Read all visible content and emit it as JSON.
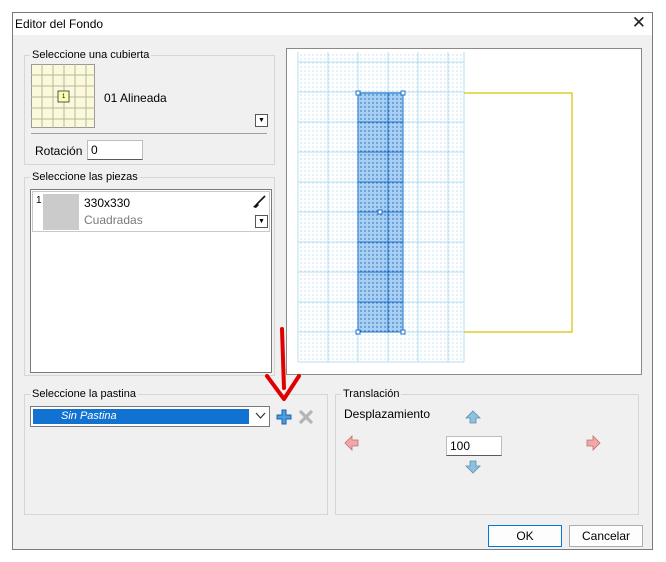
{
  "window": {
    "title": "Editor del Fondo",
    "close_glyph": "✕"
  },
  "cubierta": {
    "group_label": "Seleccione una cubierta",
    "selected": "01 Alineada",
    "thumb_marker": "1",
    "rotacion_label": "Rotación",
    "rotacion_value": "0"
  },
  "piezas": {
    "group_label": "Seleccione las piezas",
    "items": [
      {
        "index": "1",
        "size": "330x330",
        "type": "Cuadradas",
        "icon": "brush-icon"
      }
    ]
  },
  "pastina": {
    "group_label": "Seleccione la pastina",
    "selected": "Sin Pastina",
    "add_icon": "plus-icon",
    "delete_icon": "x-icon"
  },
  "translacion": {
    "group_label": "Translación",
    "desplazamiento_label": "Desplazamiento",
    "value": "100",
    "up_icon": "arrow-up-icon",
    "down_icon": "arrow-down-icon",
    "left_icon": "arrow-left-icon",
    "right_icon": "arrow-right-icon"
  },
  "buttons": {
    "ok": "OK",
    "cancel": "Cancelar"
  },
  "colors": {
    "accent": "#0078d4",
    "selection_fill": "#1172d2",
    "annotation_red": "#e00000",
    "frame_yellow": "#d9c200"
  }
}
